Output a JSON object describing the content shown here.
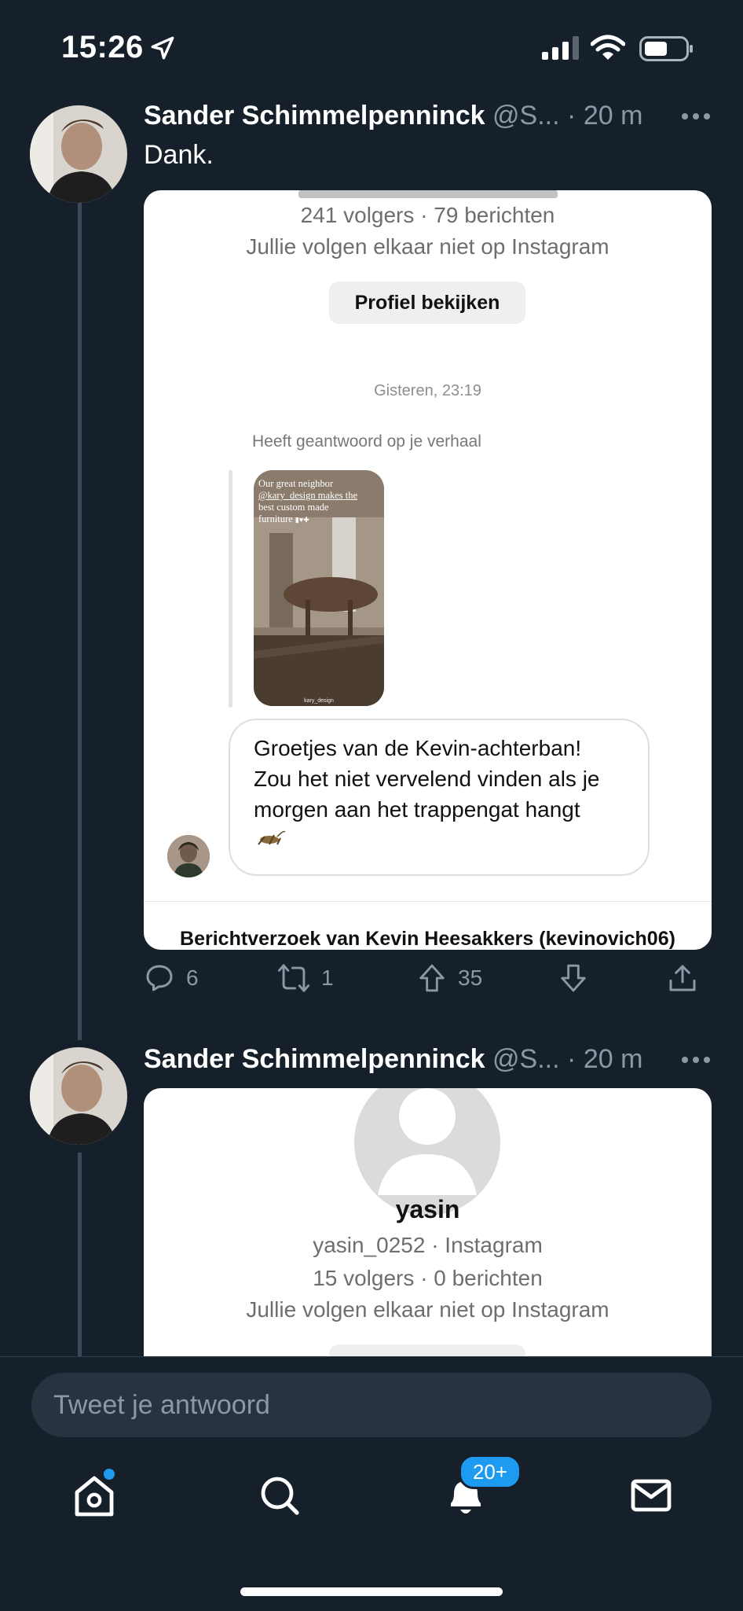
{
  "status": {
    "time": "15:26"
  },
  "tweet1": {
    "author_name": "Sander Schimmelpenninck",
    "author_handle": "@S...",
    "separator": "·",
    "time": "20 m",
    "text": "Dank.",
    "card": {
      "stats": "241 volgers · 79 berichten",
      "follow_note": "Jullie volgen elkaar niet op Instagram",
      "view_profile": "Profiel bekijken",
      "timestamp": "Gisteren, 23:19",
      "reply_label": "Heeft geantwoord op je verhaal",
      "story_caption_1": "Our great neighbor",
      "story_caption_2": "@kary_design makes the",
      "story_caption_3": "best custom made",
      "story_caption_4": "furniture",
      "story_watermark": "kary_design",
      "message_line1": "Groetjes van de Kevin-achterban!",
      "message_line2": "Zou het niet vervelend vinden als je",
      "message_line3": "morgen aan het trappengat hangt",
      "request_footer": "Berichtverzoek van Kevin Heesakkers (kevinovich06)"
    },
    "actions": {
      "replies": "6",
      "retweets": "1",
      "upvotes": "35"
    }
  },
  "tweet2": {
    "author_name": "Sander Schimmelpenninck",
    "author_handle": "@S...",
    "separator": "·",
    "time": "20 m",
    "card": {
      "name": "yasin",
      "username": "yasin_0252 · Instagram",
      "stats": "15 volgers · 0 berichten",
      "follow_note": "Jullie volgen elkaar niet op Instagram"
    }
  },
  "reply_placeholder": "Tweet je antwoord",
  "tabbar": {
    "notification_badge": "20+"
  },
  "colors": {
    "background": "#15202b",
    "accent": "#1d9bf0",
    "muted": "#8b98a5"
  }
}
